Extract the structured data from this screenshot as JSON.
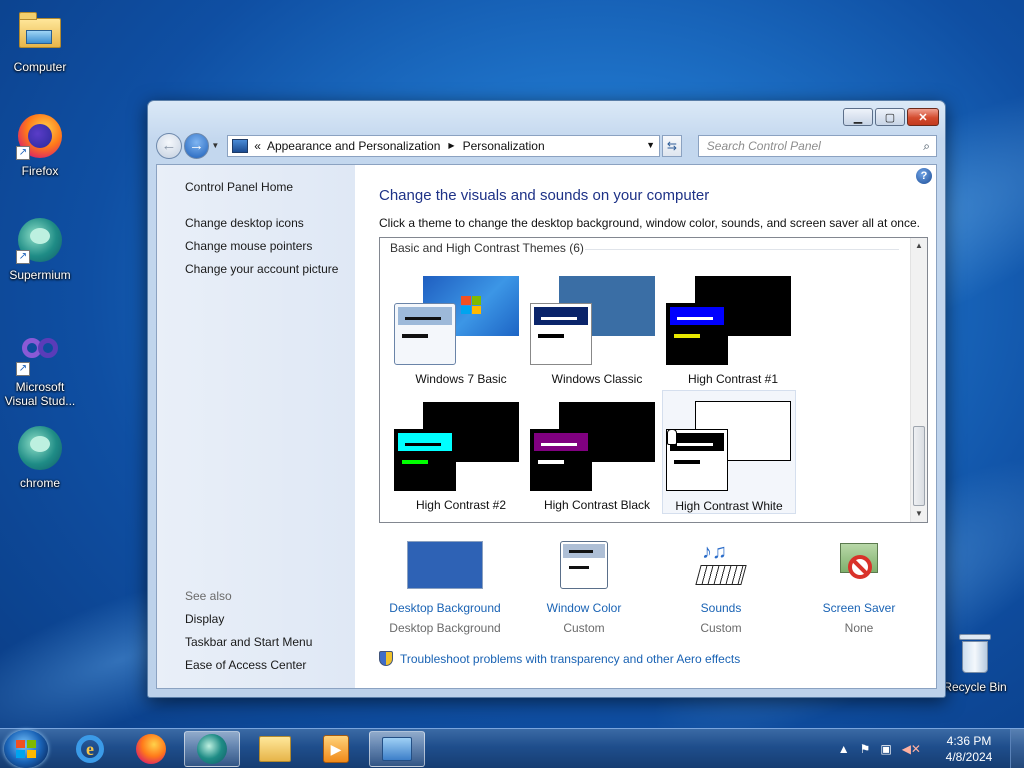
{
  "desktop": {
    "icons": [
      {
        "label": "Computer",
        "icon": "computer-icon"
      },
      {
        "label": "Firefox",
        "icon": "firefox-icon"
      },
      {
        "label": "Supermium",
        "icon": "supermium-icon"
      },
      {
        "label": "Microsoft Visual Stud...",
        "icon": "visual-studio-icon"
      },
      {
        "label": "chrome",
        "icon": "chrome-icon"
      },
      {
        "label": "Recycle Bin",
        "icon": "recycle-bin-icon"
      }
    ]
  },
  "window": {
    "address": {
      "prefix": "«",
      "crumbs": [
        "Appearance and Personalization",
        "Personalization"
      ]
    },
    "search_placeholder": "Search Control Panel",
    "left_pane": {
      "links": [
        "Control Panel Home",
        "Change desktop icons",
        "Change mouse pointers",
        "Change your account picture"
      ],
      "see_also_heading": "See also",
      "see_also": [
        "Display",
        "Taskbar and Start Menu",
        "Ease of Access Center"
      ]
    },
    "main": {
      "title": "Change the visuals and sounds on your computer",
      "description": "Click a theme to change the desktop background, window color, sounds, and screen saver all at once.",
      "group_heading": "Basic and High Contrast Themes (6)",
      "themes": [
        {
          "label": "Windows 7 Basic",
          "bg": "#2a78d2",
          "win_bg": "#cfdceb",
          "bar": "#9db9d9",
          "l1": "#111",
          "l2": "#111"
        },
        {
          "label": "Windows Classic",
          "bg": "#3a6ea5",
          "win_bg": "#ffffff",
          "bar": "#0a246a",
          "l1": "#ffffff",
          "l2": "#000000"
        },
        {
          "label": "High Contrast #1",
          "bg": "#000000",
          "win_bg": "#000000",
          "bar": "#0000ff",
          "l1": "#ffffff",
          "l2": "#e8e800"
        },
        {
          "label": "High Contrast #2",
          "bg": "#000000",
          "win_bg": "#000000",
          "bar": "#00ffff",
          "l1": "#000000",
          "l2": "#00ff00"
        },
        {
          "label": "High Contrast Black",
          "bg": "#000000",
          "win_bg": "#000000",
          "bar": "#800080",
          "l1": "#ffffff",
          "l2": "#ffffff"
        },
        {
          "label": "High Contrast White",
          "bg": "#ffffff",
          "win_bg": "#ffffff",
          "bar": "#000000",
          "l1": "#ffffff",
          "l2": "#000000"
        }
      ],
      "selected_theme": "High Contrast White",
      "settings": [
        {
          "link": "Desktop Background",
          "value": "Desktop Background"
        },
        {
          "link": "Window Color",
          "value": "Custom"
        },
        {
          "link": "Sounds",
          "value": "Custom"
        },
        {
          "link": "Screen Saver",
          "value": "None"
        }
      ],
      "troubleshoot": "Troubleshoot problems with transparency and other Aero effects"
    }
  },
  "taskbar": {
    "pinned": [
      "internet-explorer-icon",
      "firefox-icon",
      "supermium-icon",
      "file-explorer-icon",
      "media-player-icon",
      "control-panel-icon"
    ],
    "time": "4:36 PM",
    "date": "4/8/2024"
  },
  "colors": {
    "link": "#1a63b4",
    "title": "#1e3287"
  }
}
